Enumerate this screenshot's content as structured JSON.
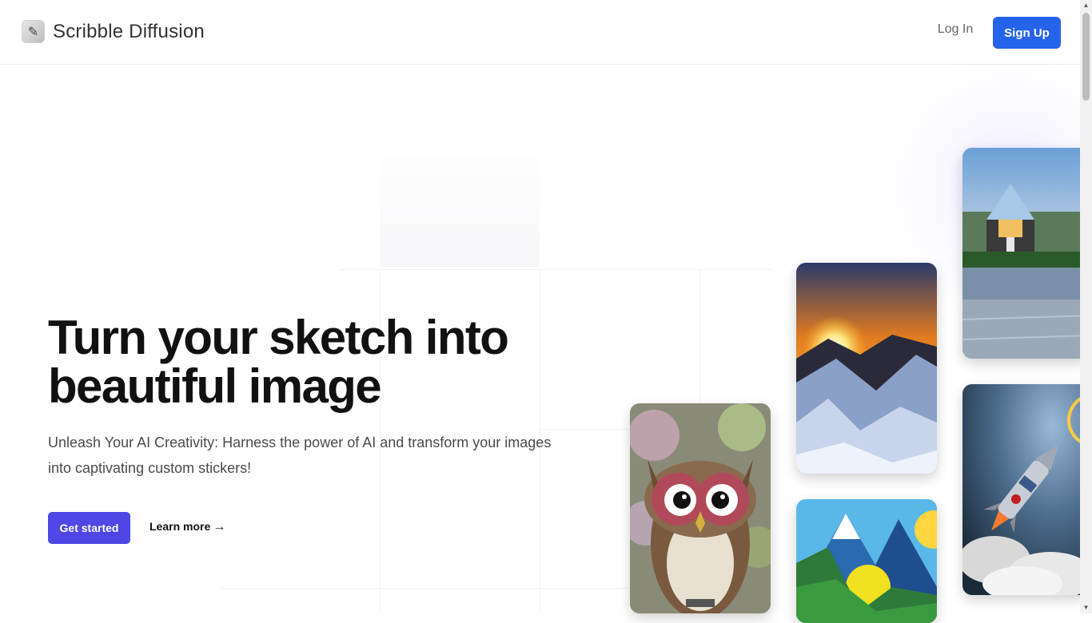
{
  "header": {
    "brand_name": "Scribble Diffusion",
    "brand_icon": "pencil-logo-icon",
    "login_label": "Log In",
    "signup_label": "Sign Up"
  },
  "hero": {
    "title_line1": "Turn your sketch into",
    "title_line2": "beautiful image",
    "subtitle": "Unleash Your AI Creativity: Harness the power of AI and transform your images into captivating custom stickers!",
    "primary_cta": "Get started",
    "secondary_cta": "Learn more",
    "secondary_cta_icon": "arrow-right-icon"
  },
  "gallery": {
    "images": [
      "owl-illustration",
      "sunset-mountains",
      "blue-mountains-sun",
      "glass-house-lake",
      "rocket-launch"
    ]
  },
  "colors": {
    "signup": "#2563eb",
    "primary_cta": "#4f46e5",
    "title": "#111111",
    "subtitle": "#4b4b4b"
  }
}
